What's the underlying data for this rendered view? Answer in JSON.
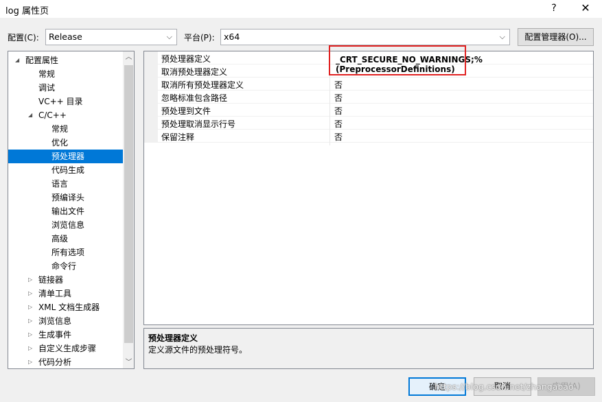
{
  "window": {
    "title": "log 属性页",
    "help_label": "?",
    "close_label": "✕"
  },
  "config": {
    "label": "配置(C):",
    "value": "Release",
    "platform_label": "平台(P):",
    "platform_value": "x64",
    "manager_label": "配置管理器(O)..."
  },
  "tree": {
    "items": [
      {
        "label": "配置属性",
        "expander": "◢"
      },
      {
        "label": "常规"
      },
      {
        "label": "调试"
      },
      {
        "label": "VC++ 目录"
      },
      {
        "label": "C/C++",
        "expander": "◢"
      },
      {
        "label": "常规"
      },
      {
        "label": "优化"
      },
      {
        "label": "预处理器",
        "selected": true
      },
      {
        "label": "代码生成"
      },
      {
        "label": "语言"
      },
      {
        "label": "预编译头"
      },
      {
        "label": "输出文件"
      },
      {
        "label": "浏览信息"
      },
      {
        "label": "高级"
      },
      {
        "label": "所有选项"
      },
      {
        "label": "命令行"
      },
      {
        "label": "链接器",
        "expander": "▷"
      },
      {
        "label": "清单工具",
        "expander": "▷"
      },
      {
        "label": "XML 文档生成器",
        "expander": "▷"
      },
      {
        "label": "浏览信息",
        "expander": "▷"
      },
      {
        "label": "生成事件",
        "expander": "▷"
      },
      {
        "label": "自定义生成步骤",
        "expander": "▷"
      },
      {
        "label": "代码分析",
        "expander": "▷"
      }
    ]
  },
  "grid": {
    "rows": [
      {
        "name": "预处理器定义",
        "value": "_CRT_SECURE_NO_WARNINGS;%(PreprocessorDefinitions)"
      },
      {
        "name": "取消预处理器定义",
        "value": ""
      },
      {
        "name": "取消所有预处理器定义",
        "value": "否"
      },
      {
        "name": "忽略标准包含路径",
        "value": "否"
      },
      {
        "name": "预处理到文件",
        "value": "否"
      },
      {
        "name": "预处理取消显示行号",
        "value": "否"
      },
      {
        "name": "保留注释",
        "value": "否"
      }
    ]
  },
  "description": {
    "title": "预处理器定义",
    "text": "定义源文件的预处理符号。"
  },
  "buttons": {
    "ok": "确定",
    "cancel": "取消",
    "apply": "应用(A)"
  },
  "watermark": "https://blog.csdn.net/zhangabao",
  "colors": {
    "selection": "#0078d7",
    "highlight_box": "#e02020",
    "ok_border": "#0078d7"
  }
}
